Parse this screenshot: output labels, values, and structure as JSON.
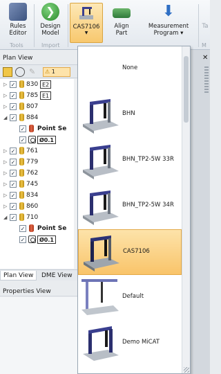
{
  "ribbon": {
    "buttons": {
      "rules_editor": [
        "Rules",
        "Editor"
      ],
      "design_model": [
        "Design",
        "Model"
      ],
      "cmm": "CAS7106",
      "align_part": [
        "Align",
        "Part"
      ],
      "measurement_program": [
        "Measurement",
        "Program"
      ]
    },
    "groups": {
      "tools": "Tools",
      "import": "Import",
      "partial": "M"
    },
    "cutoff_label": "Ta"
  },
  "plan_view": {
    "title": "Plan View",
    "warning_count": "1",
    "rows": [
      {
        "label": "830",
        "tag": "E2",
        "expanded": false
      },
      {
        "label": "785",
        "tag": "E1",
        "expanded": false
      },
      {
        "label": "807",
        "expanded": false
      },
      {
        "label": "884",
        "expanded": true
      },
      {
        "label": "Point Se",
        "sub": true,
        "bold": true
      },
      {
        "label": "Ø0.1",
        "sub": true,
        "bold": true,
        "symbol": true
      },
      {
        "label": "761",
        "expanded": false
      },
      {
        "label": "779",
        "expanded": false
      },
      {
        "label": "762",
        "expanded": false
      },
      {
        "label": "745",
        "expanded": false
      },
      {
        "label": "834",
        "expanded": false
      },
      {
        "label": "860",
        "expanded": false
      },
      {
        "label": "710",
        "expanded": true
      },
      {
        "label": "Point Se",
        "sub": true,
        "bold": true
      },
      {
        "label": "Ø0.1",
        "sub": true,
        "bold": true,
        "symbol": true
      }
    ]
  },
  "tabs": [
    "Plan View",
    "DME View"
  ],
  "properties_view": {
    "title": "Properties View"
  },
  "dropdown": {
    "items": [
      "None",
      "BHN",
      "BHN_TP2-5W 33R",
      "BHN_TP2-5W 34R",
      "CAS7106",
      "Default",
      "Demo MiCAT"
    ],
    "selected": "CAS7106"
  },
  "colors": {
    "selection": "#f9c46a",
    "selection_border": "#e3a948"
  }
}
